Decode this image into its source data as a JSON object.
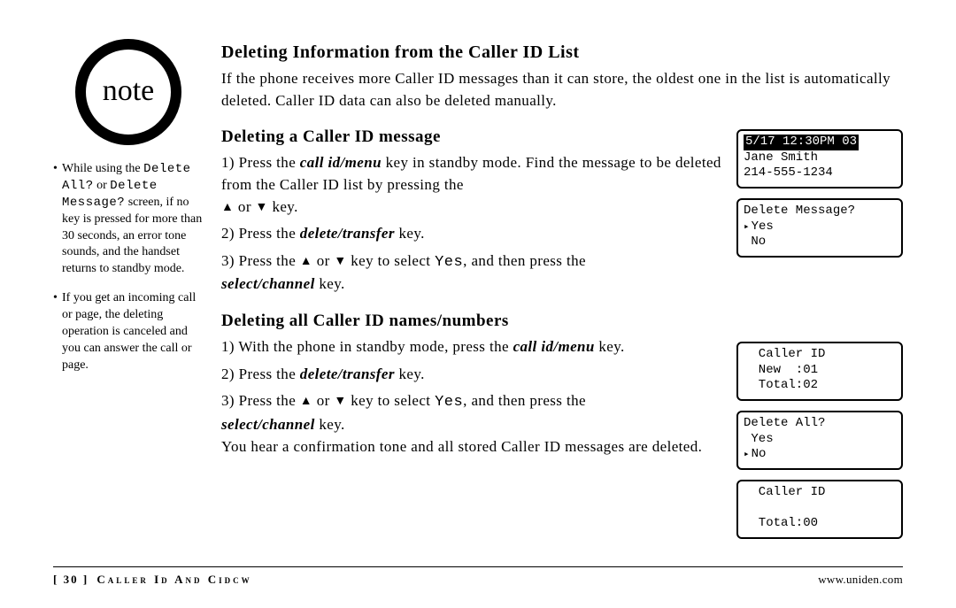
{
  "note_label": "note",
  "sidenotes": {
    "n1_pre": "While using the ",
    "n1_lcd1": "Delete All?",
    "n1_mid": " or ",
    "n1_lcd2": "Delete Message?",
    "n1_post": " screen, if no key is pressed for more than 30 seconds, an error tone sounds, and the handset returns to standby mode.",
    "n2": "If you get an incoming call or page, the deleting operation is canceled and you can answer the call or page."
  },
  "headings": {
    "h1": "Deleting Information from the Caller ID List",
    "h2": "Deleting a Caller ID message",
    "h3": "Deleting all Caller ID names/numbers"
  },
  "intro": "If the phone receives more Caller ID messages than it can store, the oldest one in the list is automatically deleted. Caller ID data can also be deleted manually.",
  "key": {
    "callid": "call id/menu",
    "deltrans": "delete/transfer",
    "selchan": "select/channel"
  },
  "words": {
    "yes": "Yes",
    "press_the": "Press the ",
    "key": " key.",
    "or": " or ",
    "the": "the",
    "with_phone": "With the phone in standby mode, press the ",
    "step1a_tail": " key in standby mode. Find the message to be deleted from the Caller ID list by pressing ",
    "step3a_pre": "Press the ",
    "step3a_mid": " key to select ",
    "step3a_post": ", and then press the ",
    "confirm": "You hear a confirmation tone and all stored Caller ID messages are deleted."
  },
  "screens": {
    "s1": {
      "l1": "5/17 12:30PM 03",
      "l2": "Jane Smith",
      "l3": "214-555-1234"
    },
    "s2": {
      "l1": "Delete Message?",
      "l2": "Yes",
      "l3": "No"
    },
    "s3": {
      "l1": "  Caller ID",
      "l2": "  New  :01",
      "l3": "  Total:02"
    },
    "s4": {
      "l1": "Delete All?",
      "l2": " Yes",
      "l3": "No"
    },
    "s5": {
      "l1": "  Caller ID",
      "l2": " ",
      "l3": "  Total:00"
    }
  },
  "footer": {
    "page": "[ 30 ]",
    "section": "Caller Id And Cidcw",
    "url": "www.uniden.com"
  }
}
